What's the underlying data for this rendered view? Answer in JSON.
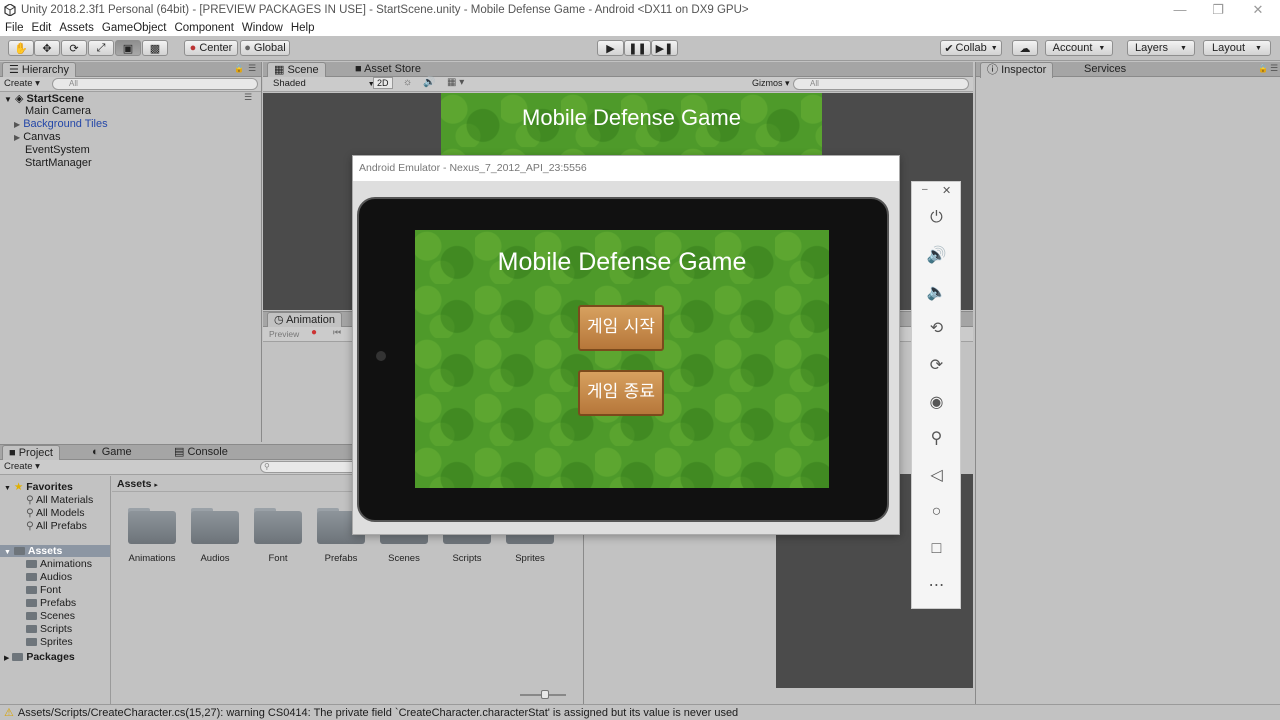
{
  "window": {
    "title": "Unity 2018.2.3f1 Personal (64bit) - [PREVIEW PACKAGES IN USE] - StartScene.unity - Mobile Defense Game - Android <DX11 on DX9 GPU>"
  },
  "menu": [
    "File",
    "Edit",
    "Assets",
    "GameObject",
    "Component",
    "Window",
    "Help"
  ],
  "toolbar": {
    "pivot_label": "Center",
    "space_label": "Global",
    "collab_label": "Collab",
    "account_label": "Account",
    "layers_label": "Layers",
    "layout_label": "Layout"
  },
  "hierarchy": {
    "tab": "Hierarchy",
    "create": "Create",
    "search_placeholder": "All",
    "scene_name": "StartScene",
    "items": [
      "Main Camera",
      "Background Tiles",
      "Canvas",
      "EventSystem",
      "StartManager"
    ]
  },
  "scene": {
    "tab_scene": "Scene",
    "tab_store": "Asset Store",
    "shading": "Shaded",
    "mode_2d": "2D",
    "gizmos": "Gizmos",
    "search_placeholder": "All",
    "game_title": "Mobile Defense Game"
  },
  "animation": {
    "tab": "Animation",
    "preview": "Preview"
  },
  "inspector": {
    "tab_inspector": "Inspector",
    "tab_services": "Services"
  },
  "project": {
    "tab_project": "Project",
    "tab_game": "Game",
    "tab_console": "Console",
    "create": "Create",
    "breadcrumb": "Assets",
    "favorites_label": "Favorites",
    "favorites": [
      "All Materials",
      "All Models",
      "All Prefabs"
    ],
    "assets_label": "Assets",
    "asset_tree": [
      "Animations",
      "Audios",
      "Font",
      "Prefabs",
      "Scenes",
      "Scripts",
      "Sprites"
    ],
    "packages_label": "Packages",
    "folders": [
      "Animations",
      "Audios",
      "Font",
      "Prefabs",
      "Scenes",
      "Scripts",
      "Sprites"
    ]
  },
  "emulator": {
    "title": "Android Emulator - Nexus_7_2012_API_23:5556",
    "game_title": "Mobile Defense Game",
    "start_button": "게임 시작",
    "quit_button": "게임 종료",
    "side_icons": [
      "power-icon",
      "volume-up-icon",
      "volume-down-icon",
      "rotate-left-icon",
      "rotate-right-icon",
      "camera-icon",
      "zoom-icon",
      "back-icon",
      "home-icon",
      "overview-icon",
      "more-icon"
    ]
  },
  "status": {
    "message": "Assets/Scripts/CreateCharacter.cs(15,27): warning CS0414: The private field `CreateCharacter.characterStat' is assigned but its value is never used"
  }
}
